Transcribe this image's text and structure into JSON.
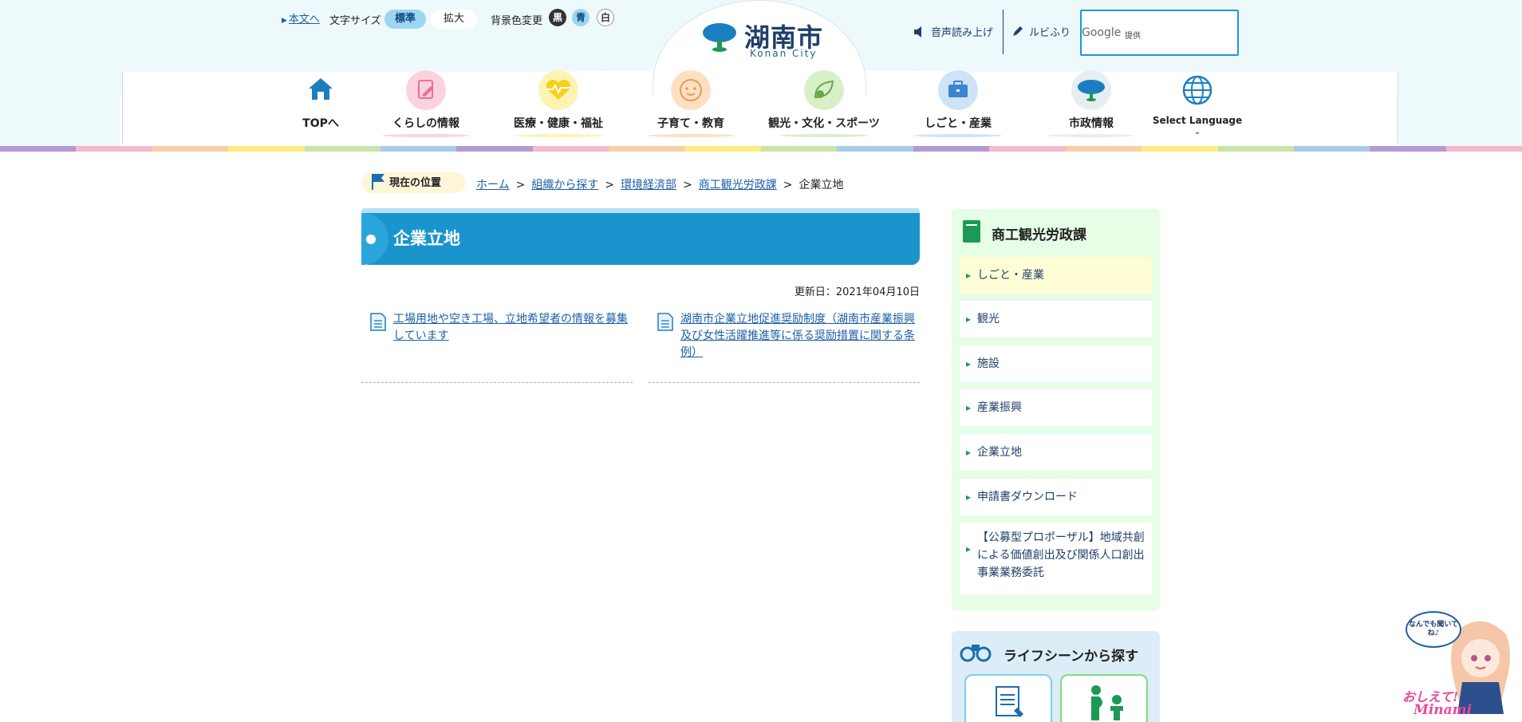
{
  "header": {
    "skip_link": "本文へ",
    "font_size_label": "文字サイズ",
    "font_size_standard": "標準",
    "font_size_large": "拡大",
    "bg_color_label": "背景色変更",
    "bg_black": "黒",
    "bg_blue": "青",
    "bg_white": "白",
    "logo_title": "湖南市",
    "logo_subtitle": "Konan City",
    "voice_button": "音声読み上げ",
    "ruby_button": "ルビふり",
    "search_brand": "Google",
    "search_provided": "提供"
  },
  "nav": {
    "items": [
      {
        "label": "TOPへ",
        "icon": "home-icon"
      },
      {
        "label": "くらしの情報",
        "icon": "notepad-icon"
      },
      {
        "label": "医療・健康・福祉",
        "icon": "heart-pulse-icon"
      },
      {
        "label": "子育て・教育",
        "icon": "child-face-icon"
      },
      {
        "label": "観光・文化・スポーツ",
        "icon": "leaf-icon"
      },
      {
        "label": "しごと・産業",
        "icon": "briefcase-icon"
      },
      {
        "label": "市政情報",
        "icon": "city-tree-icon"
      },
      {
        "label": "Select Language",
        "icon": "globe-icon"
      }
    ]
  },
  "breadcrumb": {
    "here_label": "現在の位置",
    "items": [
      "ホーム",
      "組織から探す",
      "環境経済部",
      "商工観光労政課"
    ],
    "current": "企業立地"
  },
  "main": {
    "title": "企業立地",
    "updated": "更新日：2021年04月10日",
    "links": [
      "工場用地や空き工場、立地希望者の情報を募集しています",
      "湖南市企業立地促進奨励制度（湖南市産業振興及び女性活躍推進等に係る奨励措置に関する条例）"
    ]
  },
  "sidebar": {
    "title": "商工観光労政課",
    "items": [
      "しごと・産業",
      "観光",
      "施設",
      "産業振興",
      "企業立地",
      "申請書ダウンロード",
      "【公募型プロポーザル】地域共創による価値創出及び関係人口創出事業業務委託"
    ],
    "life_title": "ライフシーンから探す"
  },
  "assistant": {
    "bubble": "なんでも聞いてね♪",
    "logo_line1": "おしえて!",
    "logo_line2": "Minami"
  },
  "colors": {
    "accent": "#1a94cd",
    "link": "#1c5fa8",
    "sidebar_bg": "#e6fde6",
    "header_bg": "#eef9fc"
  }
}
